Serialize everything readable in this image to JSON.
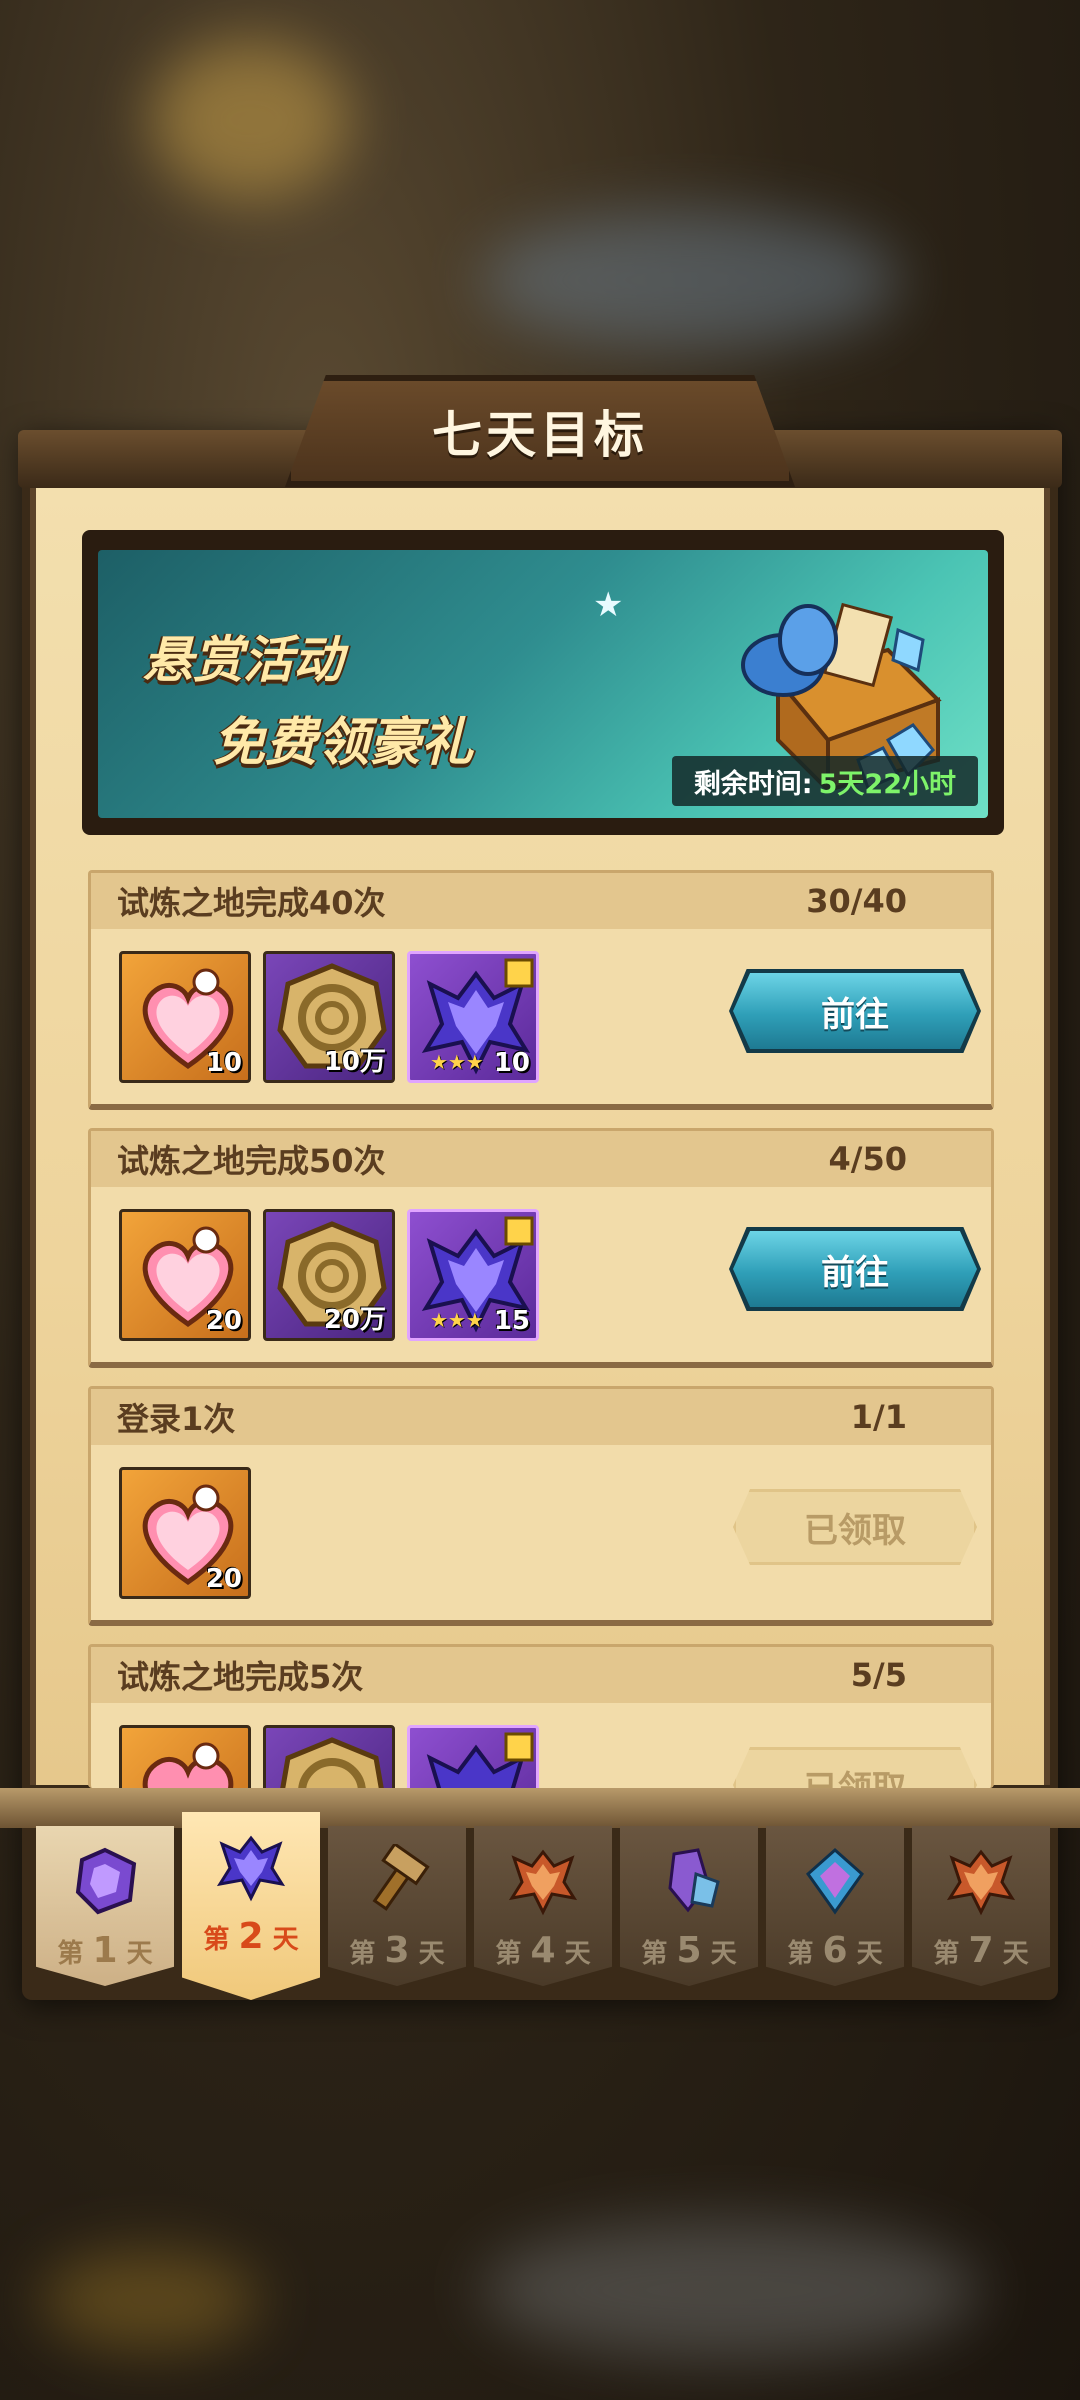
{
  "title": "七天目标",
  "banner": {
    "line1": "悬赏活动",
    "line2": "免费领豪礼",
    "timer_label": "剩余时间:",
    "timer_value": "5天22小时"
  },
  "tasks": [
    {
      "name": "试炼之地完成40次",
      "progress": "30/40",
      "rewards": [
        {
          "icon": "heart-medal-icon",
          "qty": "10"
        },
        {
          "icon": "gold-coin-icon",
          "qty": "10万"
        },
        {
          "icon": "purple-crest-icon",
          "qty": "10",
          "stars": "★★★"
        }
      ],
      "button": "前往",
      "state": "go"
    },
    {
      "name": "试炼之地完成50次",
      "progress": "4/50",
      "rewards": [
        {
          "icon": "heart-medal-icon",
          "qty": "20"
        },
        {
          "icon": "gold-coin-icon",
          "qty": "20万"
        },
        {
          "icon": "purple-crest-icon",
          "qty": "15",
          "stars": "★★★"
        }
      ],
      "button": "前往",
      "state": "go"
    },
    {
      "name": "登录1次",
      "progress": "1/1",
      "rewards": [
        {
          "icon": "heart-medal-icon",
          "qty": "20"
        }
      ],
      "button": "已领取",
      "state": "done"
    },
    {
      "name": "试炼之地完成5次",
      "progress": "5/5",
      "rewards": [
        {
          "icon": "heart-medal-icon",
          "qty": ""
        },
        {
          "icon": "gold-coin-icon",
          "qty": ""
        },
        {
          "icon": "purple-crest-icon",
          "qty": ""
        }
      ],
      "button": "已领取",
      "state": "done"
    }
  ],
  "tabs": [
    {
      "prefix": "第",
      "num": "1",
      "suffix": "天",
      "icon": "purple-gem-icon"
    },
    {
      "prefix": "第",
      "num": "2",
      "suffix": "天",
      "icon": "purple-crest-icon",
      "active": true
    },
    {
      "prefix": "第",
      "num": "3",
      "suffix": "天",
      "icon": "hammer-icon"
    },
    {
      "prefix": "第",
      "num": "4",
      "suffix": "天",
      "icon": "orange-crest-icon"
    },
    {
      "prefix": "第",
      "num": "5",
      "suffix": "天",
      "icon": "crystal-icon"
    },
    {
      "prefix": "第",
      "num": "6",
      "suffix": "天",
      "icon": "diamond-icon"
    },
    {
      "prefix": "第",
      "num": "7",
      "suffix": "天",
      "icon": "orange-crest-icon"
    }
  ],
  "colors": {
    "go_button": "#2f9fb8",
    "done_button": "#ecd59f",
    "timer_value": "#7ef36a",
    "active_tab_text": "#d84a1a"
  }
}
